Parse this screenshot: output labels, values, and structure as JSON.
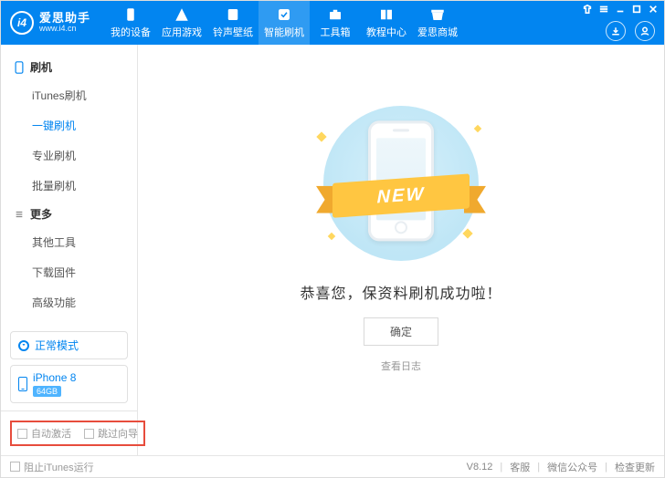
{
  "brand": {
    "title": "爱思助手",
    "subtitle": "www.i4.cn",
    "logo_text": "i4"
  },
  "nav": {
    "items": [
      {
        "label": "我的设备"
      },
      {
        "label": "应用游戏"
      },
      {
        "label": "铃声壁纸"
      },
      {
        "label": "智能刷机"
      },
      {
        "label": "工具箱"
      },
      {
        "label": "教程中心"
      },
      {
        "label": "爱思商城"
      }
    ],
    "active_index": 3
  },
  "sidebar": {
    "group1_title": "刷机",
    "group1": [
      {
        "label": "iTunes刷机"
      },
      {
        "label": "一键刷机"
      },
      {
        "label": "专业刷机"
      },
      {
        "label": "批量刷机"
      }
    ],
    "group1_active": 1,
    "group2_title": "更多",
    "group2": [
      {
        "label": "其他工具"
      },
      {
        "label": "下载固件"
      },
      {
        "label": "高级功能"
      }
    ],
    "status_label": "正常模式",
    "device_name": "iPhone 8",
    "device_capacity": "64GB",
    "opt_auto_activate": "自动激活",
    "opt_skip_guide": "跳过向导"
  },
  "main": {
    "ribbon_text": "NEW",
    "message": "恭喜您，保资料刷机成功啦！",
    "ok_label": "确定",
    "log_label": "查看日志"
  },
  "footer": {
    "block_itunes": "阻止iTunes运行",
    "version": "V8.12",
    "support": "客服",
    "wechat": "微信公众号",
    "update": "检查更新"
  }
}
